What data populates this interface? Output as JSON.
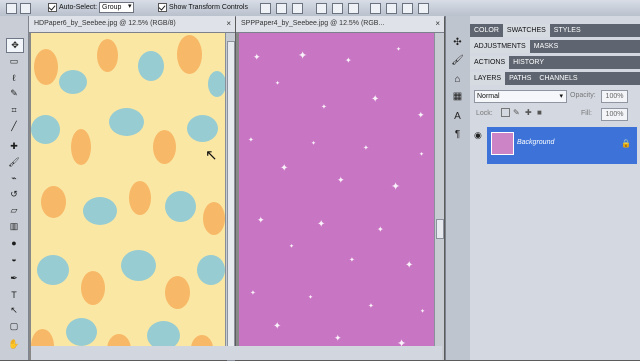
{
  "options_bar": {
    "auto_select_label": "Auto-Select:",
    "auto_select_value": "Group",
    "show_transform_label": "Show Transform Controls"
  },
  "documents": [
    {
      "title": "HDPaper6_by_Seebee.jpg @ 12.5% (RGB/8)",
      "close": "×"
    },
    {
      "title": "SPPPaper4_by_Seebee.jpg @ 12.5% (RGB...",
      "close": "×"
    }
  ],
  "panels": {
    "group1_tabs": [
      "COLOR",
      "SWATCHES",
      "STYLES"
    ],
    "group2_tabs": [
      "ADJUSTMENTS",
      "MASKS"
    ],
    "group3_tabs": [
      "ACTIONS",
      "HISTORY"
    ],
    "layers_tabs": [
      "LAYERS",
      "PATHS",
      "CHANNELS"
    ],
    "blend_mode": "Normal",
    "opacity_label": "Opacity:",
    "opacity_value": "100%",
    "lock_label": "Lock:",
    "fill_label": "Fill:",
    "fill_value": "100%",
    "layer_name": "Background"
  },
  "colors": {
    "selected_layer": "#3d73d8",
    "pink_canvas": "#c875c3",
    "blue_flower": "#67bfe8",
    "orange_flower": "#f5a24a"
  }
}
